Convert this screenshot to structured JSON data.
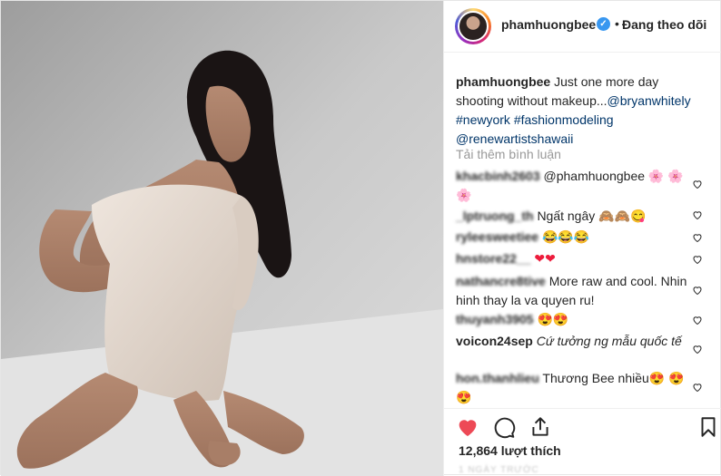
{
  "header": {
    "username": "phamhuongbee",
    "verified_icon": "verified-badge-icon",
    "separator": "•",
    "follow_label": "Đang theo dõi"
  },
  "caption": {
    "username": "phamhuongbee",
    "text": "Just one more day shooting without makeup...",
    "mention": "@bryanwhitely",
    "hashtag1": "#newyork",
    "hashtag2": "#fashionmodeling",
    "mention2": "@renewartistshawaii"
  },
  "load_more": "Tải thêm bình luận",
  "comments": [
    {
      "username": "khacbinh2603",
      "text": "@phamhuongbee 🌸 🌸🌸"
    },
    {
      "username": "_lptruong_th",
      "text": "Ngất ngây 🙈🙈😋"
    },
    {
      "username": "ryleesweetiee",
      "text": "😂😂😂"
    },
    {
      "username": "hnstore22__",
      "text": "❤❤"
    },
    {
      "username": "nathancre8tive",
      "text": "More raw and cool. Nhin hinh thay la va quyen ru!"
    },
    {
      "username": "thuyanh3905",
      "text": "😍😍"
    },
    {
      "username": "voicon24sep",
      "text": "Cứ tưởng ng mẫu quốc tế"
    },
    {
      "username": "hon.thanhlieu",
      "text": "Thương Bee nhiều😍 😍😍"
    }
  ],
  "actions": {
    "like_icon": "heart-filled-icon",
    "comment_icon": "comment-icon",
    "share_icon": "share-icon",
    "save_icon": "bookmark-icon",
    "like_color": "#ed4956"
  },
  "likes_text": "12,864 lượt thích",
  "timestamp": "1 NGÀY TRƯỚC"
}
